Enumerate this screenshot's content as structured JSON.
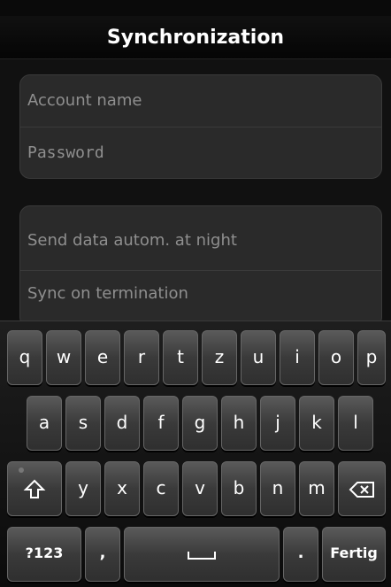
{
  "header": {
    "title": "Synchronization"
  },
  "account_panel": {
    "account_name_placeholder": "Account name",
    "password_placeholder": "Password"
  },
  "sync_panel": {
    "send_data_label": "Send data autom. at night",
    "sync_on_termination_label": "Sync on termination"
  },
  "keyboard": {
    "row1": [
      "q",
      "w",
      "e",
      "r",
      "t",
      "z",
      "u",
      "i",
      "o",
      "p"
    ],
    "row2": [
      "a",
      "s",
      "d",
      "f",
      "g",
      "h",
      "j",
      "k",
      "l"
    ],
    "row3": [
      "y",
      "x",
      "c",
      "v",
      "b",
      "n",
      "m"
    ],
    "bottom": {
      "mode_label": "?123",
      "comma_label": ",",
      "period_label": ".",
      "done_label": "Fertig"
    },
    "icons": {
      "shift": "shift-icon",
      "backspace": "backspace-icon",
      "space": "space-icon"
    }
  },
  "colors": {
    "background": "#111111",
    "panel": "#2a2a2a",
    "text_hint": "#8f8f8f",
    "key": "#3a3a3a"
  }
}
